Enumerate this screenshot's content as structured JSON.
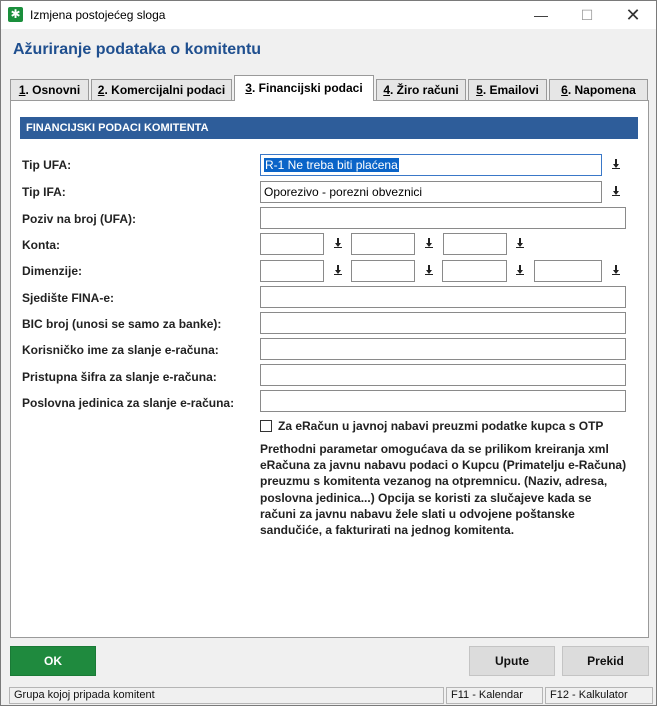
{
  "window": {
    "title": "Izmjena postojećeg sloga",
    "minimize": "—",
    "maximize": "☐",
    "close": "✕"
  },
  "heading": "Ažuriranje podataka o komitentu",
  "tabs": [
    {
      "num": "1",
      "label": ". Osnovni"
    },
    {
      "num": "2",
      "label": ". Komercijalni podaci"
    },
    {
      "num": "3",
      "label": ". Financijski podaci"
    },
    {
      "num": "4",
      "label": ". Žiro računi"
    },
    {
      "num": "5",
      "label": ". Emailovi"
    },
    {
      "num": "6",
      "label": ". Napomena"
    }
  ],
  "active_tab": "3",
  "section_title": "FINANCIJSKI PODACI KOMITENTA",
  "fields": {
    "tip_ufa": {
      "label": "Tip UFA:",
      "value": "R-1 Ne treba biti plaćena"
    },
    "tip_ifa": {
      "label": "Tip IFA:",
      "value": "Oporezivo - porezni obveznici"
    },
    "poziv": {
      "label": "Poziv na broj (UFA):",
      "value": ""
    },
    "konta": {
      "label": "Konta:"
    },
    "dimenzije": {
      "label": "Dimenzije:"
    },
    "sjediste": {
      "label": "Sjedište FINA-e:",
      "value": ""
    },
    "bic": {
      "label": "BIC broj (unosi se samo za banke):",
      "value": ""
    },
    "korisnicko": {
      "label": "Korisničko ime za slanje e-računa:",
      "value": ""
    },
    "sifra": {
      "label": "Pristupna šifra za slanje e-računa:",
      "value": ""
    },
    "poslovna": {
      "label": "Poslovna jedinica za slanje e-računa:",
      "value": ""
    }
  },
  "checkbox": {
    "label": "Za eRačun u javnoj nabavi preuzmi podatke kupca s OTP",
    "checked": false
  },
  "note": "Prethodni parametar omogućava da se prilikom kreiranja xml eRačuna za javnu nabavu  podaci o Kupcu (Primatelju e-Računa) preuzmu s komitenta vezanog na otpremnicu. (Naziv, adresa, poslovna jedinica...) Opcija se koristi za slučajeve kada se računi za javnu nabavu žele slati u odvojene poštanske sandučiće, a fakturirati na jednog komitenta.",
  "buttons": {
    "ok": "OK",
    "upute": "Upute",
    "prekid": "Prekid"
  },
  "status": {
    "left": "Grupa kojoj pripada komitent",
    "f11": "F11 - Kalendar",
    "f12": "F12 - Kalkulator"
  },
  "colors": {
    "accent": "#1f4f8f",
    "section": "#2e5d9a",
    "ok": "#1f8a3e"
  }
}
